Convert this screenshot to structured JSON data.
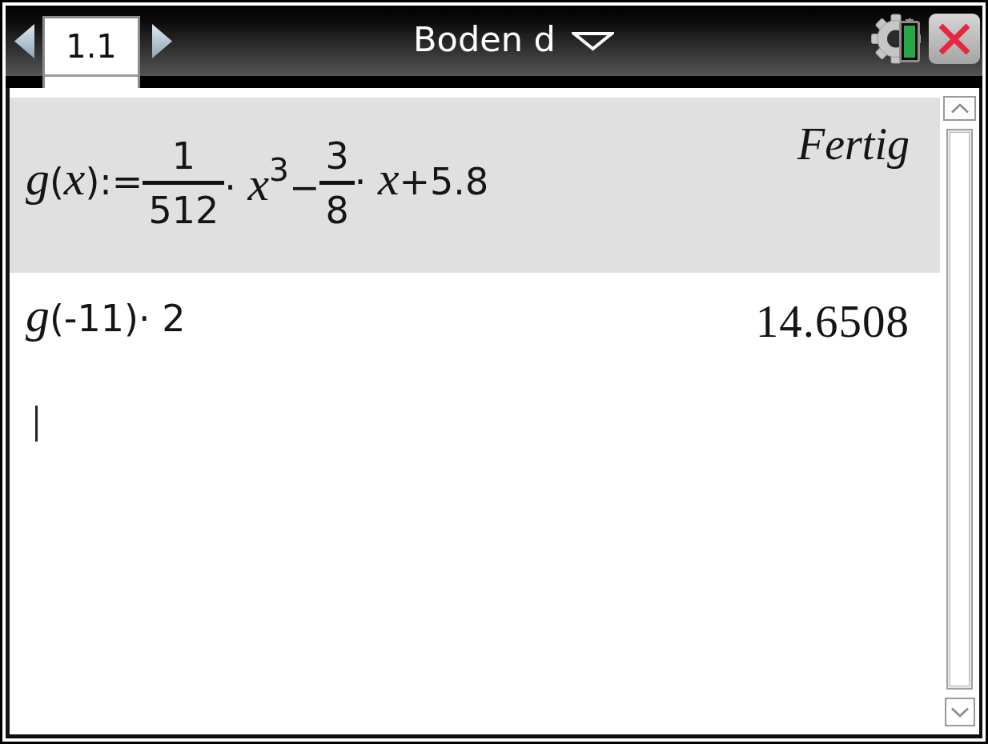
{
  "toolbar": {
    "tabs": [
      {
        "label": "1.1",
        "selected": true
      }
    ],
    "document_title": "Boden d"
  },
  "history": [
    {
      "selected": true,
      "input": [
        {
          "kind": "text",
          "text": "*g*(*x*):="
        },
        {
          "kind": "frac",
          "num": "1",
          "den": "512"
        },
        {
          "kind": "text",
          "text": "· *x*$^{3}$−"
        },
        {
          "kind": "frac",
          "num": "3",
          "den": "8"
        },
        {
          "kind": "text",
          "text": "· *x*+5.8"
        }
      ],
      "result": {
        "kind": "message",
        "text": "Fertig"
      }
    },
    {
      "selected": false,
      "input": [
        {
          "kind": "text",
          "text": "*g*(-11)· 2"
        }
      ],
      "result": {
        "kind": "value",
        "text": "14.6508"
      }
    }
  ]
}
